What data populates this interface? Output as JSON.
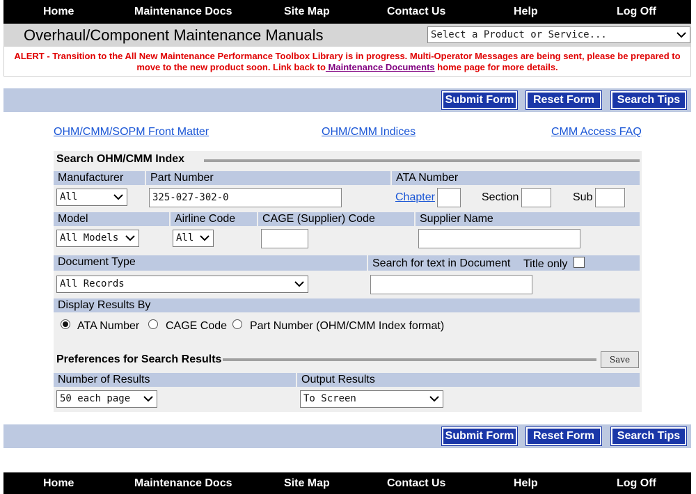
{
  "nav": {
    "home": "Home",
    "docs": "Maintenance Docs",
    "sitemap": "Site Map",
    "contact": "Contact Us",
    "help": "Help",
    "logoff": "Log Off"
  },
  "header": {
    "title": "Overhaul/Component Maintenance Manuals",
    "product_select": "Select a Product or Service..."
  },
  "alert": {
    "text_before": "ALERT - Transition to the All New Maintenance Performance Toolbox Library is in progress. Multi-Operator Messages are being sent, please be prepared to move to the new product soon. Link back to",
    "link": " Maintenance Documents",
    "text_after": " home page for more details."
  },
  "buttons": {
    "submit": "Submit Form",
    "reset": "Reset Form",
    "tips": "Search Tips"
  },
  "links": {
    "front_matter": "OHM/CMM/SOPM Front Matter",
    "indices": "OHM/CMM Indices",
    "faq": "CMM Access FAQ"
  },
  "search": {
    "title": "Search OHM/CMM Index",
    "manufacturer_label": "Manufacturer",
    "manufacturer_value": "All",
    "part_number_label": "Part Number",
    "part_number_value": "325-027-302-0",
    "ata_label": "ATA Number",
    "chapter_link": "Chapter",
    "section_label": "Section",
    "sub_label": "Sub",
    "model_label": "Model",
    "model_value": "All Models",
    "airline_label": "Airline Code",
    "airline_value": "All",
    "cage_label": "CAGE (Supplier) Code",
    "supplier_label": "Supplier Name",
    "doctype_label": "Document Type",
    "doctype_value": "All Records",
    "text_search_label": "Search for text in Document",
    "title_only_label": "Title only",
    "display_label": "Display Results By",
    "radio_ata": "ATA Number",
    "radio_cage": "CAGE Code",
    "radio_part": "Part Number (OHM/CMM Index format)"
  },
  "prefs": {
    "title": "Preferences for Search Results",
    "save": "Save",
    "num_results_label": "Number of Results",
    "num_results_value": "50 each page",
    "output_label": "Output Results",
    "output_value": "To Screen"
  },
  "icons": {
    "dropdown": "chevron-down-icon",
    "radio": "radio-button-icon",
    "checkbox": "checkbox-icon"
  },
  "colors": {
    "nav_bg": "#000000",
    "alert": "#e00000",
    "button_bg": "#1a37a8",
    "band_bg": "#bdc9e1",
    "link": "#1a56d6"
  }
}
